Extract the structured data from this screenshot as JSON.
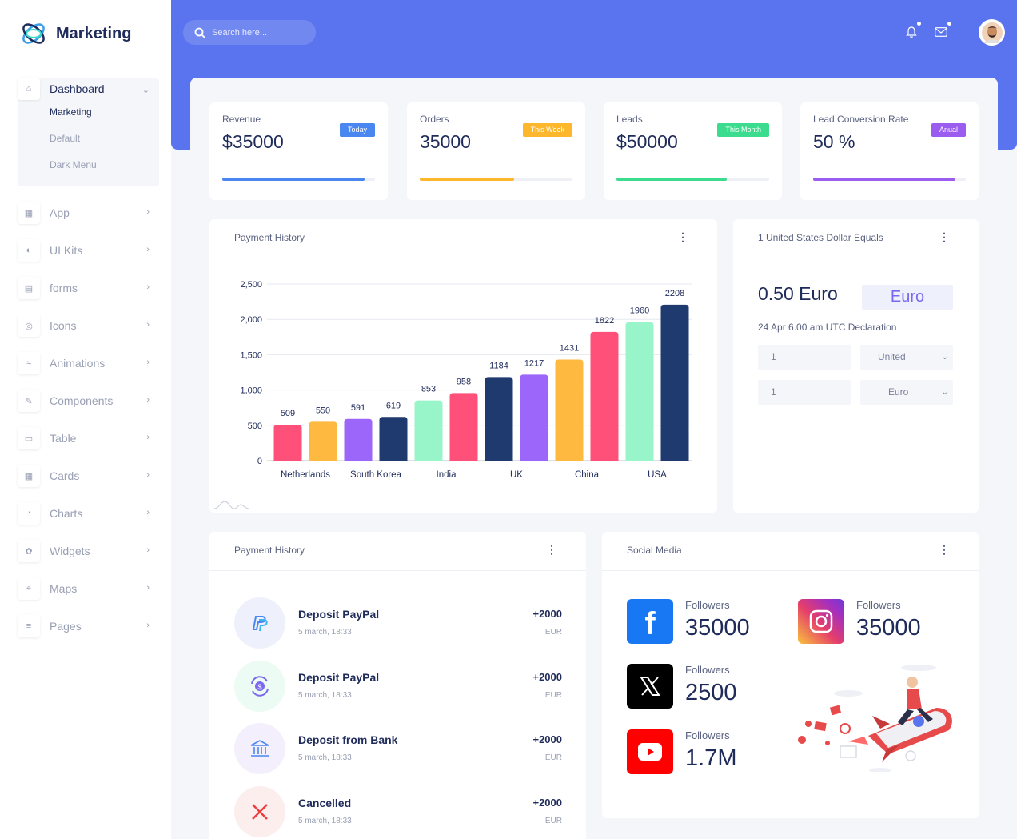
{
  "brand": {
    "name": "Marketing"
  },
  "search": {
    "placeholder": "Search here..."
  },
  "sidebar": {
    "dashboard": {
      "label": "Dashboard",
      "sub": [
        "Marketing",
        "Default",
        "Dark Menu"
      ]
    },
    "items": [
      {
        "label": "App",
        "icon": "grid-icon"
      },
      {
        "label": "UI Kits",
        "icon": "ui-kits-icon"
      },
      {
        "label": "forms",
        "icon": "form-icon"
      },
      {
        "label": "Icons",
        "icon": "icons-icon"
      },
      {
        "label": "Animations",
        "icon": "animation-icon"
      },
      {
        "label": "Components",
        "icon": "components-icon"
      },
      {
        "label": "Table",
        "icon": "table-icon"
      },
      {
        "label": "Cards",
        "icon": "cards-icon"
      },
      {
        "label": "Charts",
        "icon": "charts-icon"
      },
      {
        "label": "Widgets",
        "icon": "widgets-icon"
      },
      {
        "label": "Maps",
        "icon": "maps-icon"
      },
      {
        "label": "Pages",
        "icon": "pages-icon"
      }
    ]
  },
  "stats": [
    {
      "title": "Revenue",
      "value": "$35000",
      "badge": "Today",
      "color": "#4a86f0",
      "progress": 0.93
    },
    {
      "title": "Orders",
      "value": "35000",
      "badge": "This Week",
      "color": "#fdb72d",
      "progress": 0.62
    },
    {
      "title": "Leads",
      "value": "$50000",
      "badge": "This Month",
      "color": "#3cdc8f",
      "progress": 0.72
    },
    {
      "title": "Lead Conversion Rate",
      "value": "50 %",
      "badge": "Anual",
      "color": "#9b5cf0",
      "progress": 0.93
    }
  ],
  "payment_chart": {
    "title": "Payment History"
  },
  "chart_data": {
    "type": "bar",
    "categories": [
      "",
      "Netherlands",
      "",
      "South Korea",
      "",
      "India",
      "",
      "UK",
      "",
      "China",
      "",
      "USA"
    ],
    "values": [
      509,
      550,
      591,
      619,
      853,
      958,
      1184,
      1217,
      1431,
      1822,
      1960,
      2208
    ],
    "colors": [
      "#ff5079",
      "#fdb940",
      "#9c66fa",
      "#1f3a6f",
      "#98f5c9",
      "#ff5079",
      "#1f3a6f",
      "#9c66fa",
      "#fdb940",
      "#ff5079",
      "#98f5c9",
      "#1f3a6f"
    ],
    "yticks": [
      "0",
      "500",
      "1,000",
      "1,500",
      "2,000",
      "2,500"
    ],
    "ylim": [
      0,
      2500
    ],
    "grid": true
  },
  "converter": {
    "title": "1 United States Dollar Equals",
    "value": "0.50 Euro",
    "currency": "Euro",
    "date": "24 Apr 6.00 am UTC Declaration",
    "row1": {
      "amount": "1",
      "currency": "United"
    },
    "row2": {
      "amount": "1",
      "currency": "Euro"
    }
  },
  "payments": {
    "title": "Payment History",
    "rows": [
      {
        "name": "Deposit PayPal",
        "date": "5 march, 18:33",
        "amount": "+2000",
        "currency": "EUR",
        "icon": "paypal-icon",
        "bg": "#eef0fb"
      },
      {
        "name": "Deposit PayPal",
        "date": "5 march, 18:33",
        "amount": "+2000",
        "currency": "EUR",
        "icon": "dollar-refresh-icon",
        "bg": "#ecfbf3"
      },
      {
        "name": "Deposit from Bank",
        "date": "5 march, 18:33",
        "amount": "+2000",
        "currency": "EUR",
        "icon": "bank-icon",
        "bg": "#f3effc"
      },
      {
        "name": "Cancelled",
        "date": "5 march, 18:33",
        "amount": "+2000",
        "currency": "EUR",
        "icon": "close-icon",
        "bg": "#fdeeee"
      }
    ]
  },
  "social": {
    "title": "Social Media",
    "items": [
      {
        "network": "facebook",
        "label": "Followers",
        "value": "35000",
        "color": "#1877f2"
      },
      {
        "network": "instagram",
        "label": "Followers",
        "value": "35000",
        "color": "#d6249f"
      },
      {
        "network": "x",
        "label": "Followers",
        "value": "2500",
        "color": "#000000"
      },
      {
        "network": "youtube",
        "label": "Followers",
        "value": "1.7M",
        "color": "#ff0000"
      }
    ]
  }
}
